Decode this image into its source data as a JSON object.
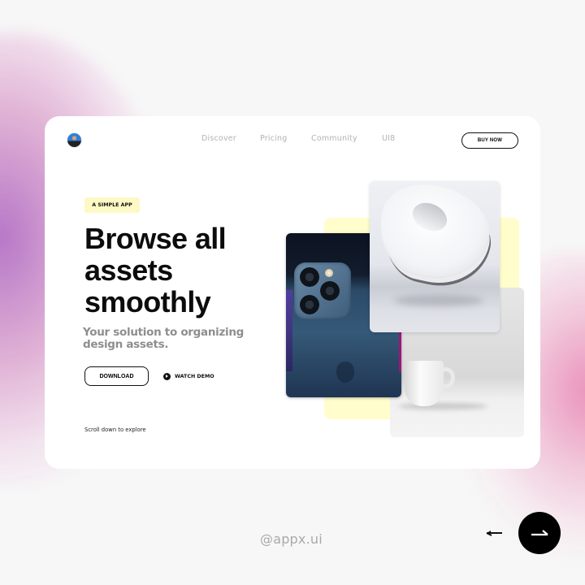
{
  "nav": {
    "avatar_alt": "user avatar",
    "links": [
      "Discover",
      "Pricing",
      "Community",
      "UI8"
    ],
    "buy_label": "BUY NOW"
  },
  "hero": {
    "badge": "A SIMPLE APP",
    "headline": [
      "Browse all",
      "assets",
      "smoothly"
    ],
    "subtitle": [
      "Your solution to organizing",
      "design assets."
    ],
    "download_label": "DOWNLOAD",
    "watch_demo_label": "WATCH DEMO",
    "scroll_hint": "Scroll down to explore"
  },
  "collage": {
    "images": [
      "iphone-camera-photo",
      "abstract-3d-shape-photo",
      "white-mug-photo"
    ],
    "accent_color": "#fffdcc"
  },
  "footer": {
    "handle": "@appx.ui",
    "prev_icon": "arrow-left-icon",
    "next_icon": "arrow-right-icon"
  },
  "colors": {
    "background": "#f7f7f7",
    "card": "#ffffff",
    "badge": "#fdf9c4",
    "text_primary": "#0c0c0c",
    "text_muted": "#8e8e8e",
    "nav_text": "#b3b3b3",
    "blob_left": "#aa5fbe",
    "blob_right": "#e66ea5"
  }
}
